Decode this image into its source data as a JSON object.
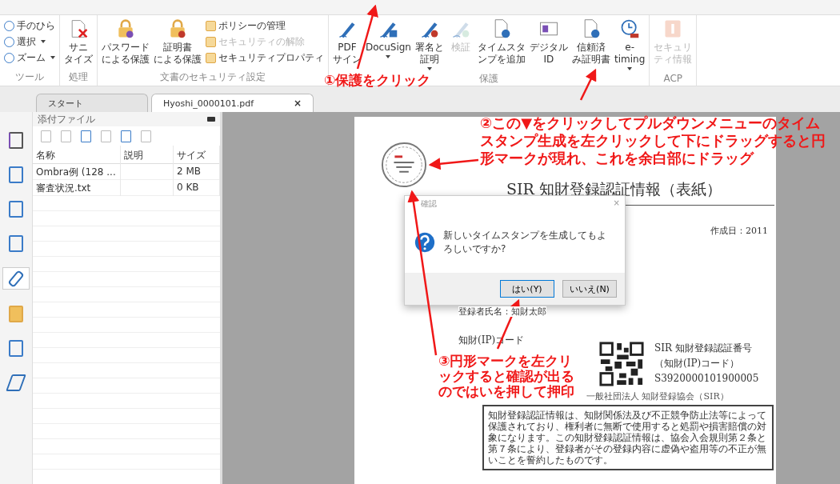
{
  "ribbon": {
    "groups": [
      {
        "label": "ツール",
        "small": [
          {
            "label": "手のひら",
            "dropdown": false,
            "disabled": false
          },
          {
            "label": "選択",
            "dropdown": true,
            "disabled": false
          },
          {
            "label": "ズーム",
            "dropdown": true,
            "disabled": false
          }
        ]
      },
      {
        "label": "処理",
        "large": [
          {
            "label": "サニタイズ",
            "dropdown": false,
            "disabled": false
          }
        ]
      },
      {
        "label": "文書のセキュリティ設定",
        "large": [
          {
            "label": "パスワードによる保護",
            "dropdown": false,
            "disabled": false
          },
          {
            "label": "証明書による保護",
            "dropdown": false,
            "disabled": false
          }
        ],
        "small_after": [
          {
            "label": "ポリシーの管理",
            "disabled": false
          },
          {
            "label": "セキュリティの解除",
            "disabled": true
          },
          {
            "label": "セキュリティプロパティ",
            "disabled": false
          }
        ]
      },
      {
        "label": "保護",
        "large": [
          {
            "label": "PDFサイン",
            "dropdown": false,
            "disabled": false
          },
          {
            "label": "DocuSign",
            "dropdown": true,
            "disabled": false
          },
          {
            "label": "署名と証明",
            "dropdown": true,
            "disabled": false
          },
          {
            "label": "検証",
            "dropdown": false,
            "disabled": true
          },
          {
            "label": "タイムスタンプを追加",
            "dropdown": false,
            "disabled": false
          },
          {
            "label": "デジタルID",
            "dropdown": false,
            "disabled": false
          },
          {
            "label": "信頼済み証明書",
            "dropdown": false,
            "disabled": false
          },
          {
            "label": "e-timing",
            "dropdown": true,
            "disabled": false
          }
        ]
      },
      {
        "label": "ACP",
        "large": [
          {
            "label": "セキュリティ情報",
            "dropdown": false,
            "disabled": true
          }
        ]
      }
    ]
  },
  "doc_tabs": [
    {
      "label": "スタート",
      "selected": false,
      "closable": false
    },
    {
      "label": "Hyoshi_0000101.pdf",
      "selected": true,
      "closable": true
    }
  ],
  "close_glyph": "×",
  "side_tools": [
    {
      "selected": false
    },
    {
      "selected": false
    },
    {
      "selected": false
    },
    {
      "selected": false
    },
    {
      "selected": true
    },
    {
      "selected": false
    },
    {
      "selected": false
    },
    {
      "selected": false
    }
  ],
  "attachments": {
    "title": "添付ファイル",
    "columns": [
      "名称",
      "説明",
      "サイズ"
    ],
    "rows": [
      {
        "name": "Ombra例 (128 ...",
        "size": "2 MB"
      },
      {
        "name": "審査状況.txt",
        "size": "0 KB"
      }
    ]
  },
  "document": {
    "title": "SIR 知財登録認証情報（表紙）",
    "created": "作成日：2011",
    "registrant": "登録者氏名：知財太郎",
    "ip_code_label": "知財(IP)コード",
    "cert_lines": [
      "SIR 知財登録認証番号",
      "（知財(IP)コード）",
      "S3920000101900005"
    ],
    "issuer": "一般社団法人 知財登録協会（SIR）",
    "notice": "知財登録認証情報は、知財関係法及び不正競争防止法等によって保護されており、権利者に無断で使用すると処罰や損害賠償の対象になります。この知財登録認証情報は、協会入会規則第２条と第７条により、登録者がその登録内容に虚偽や盗用等の不正が無いことを誓約したものです。"
  },
  "dialog": {
    "title": "確認",
    "message": "新しいタイムスタンプを生成してもよろしいですか?",
    "buttons": [
      {
        "label": "はい(Y)",
        "default": true
      },
      {
        "label": "いいえ(N)",
        "default": false
      }
    ]
  },
  "annotations": [
    "①保護をクリック",
    "②この▼をクリックしてプルダウンメニューのタイムスタンプ生成を左クリックして下にドラッグすると円形マークが現れ、これを余白部にドラッグ",
    "③円形マークを左クリックすると確認が出るのではいを押して押印"
  ]
}
